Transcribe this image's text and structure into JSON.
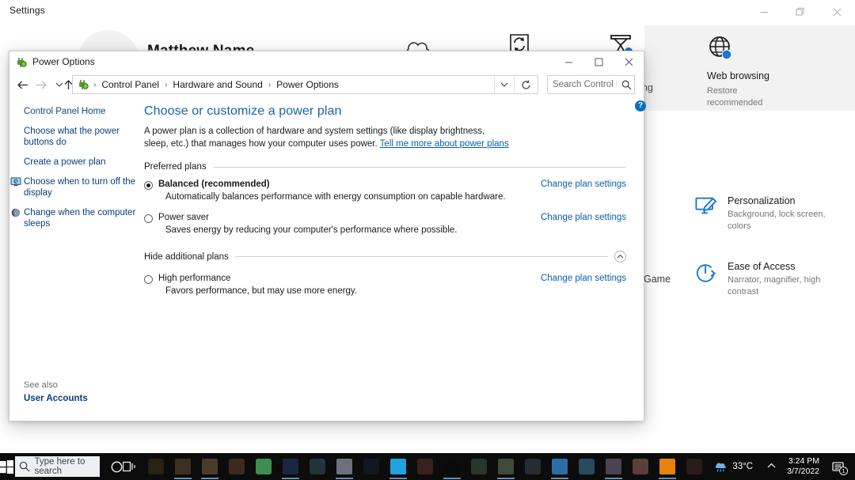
{
  "settings_app": {
    "title": "Settings",
    "window_controls": [
      {
        "name": "minimize",
        "glyph": "minimize-icon"
      },
      {
        "name": "restore",
        "glyph": "restore-icon"
      },
      {
        "name": "close",
        "glyph": "close-icon"
      }
    ],
    "partial_labels": {
      "gaming_fragment": "ng",
      "game_fragment": "Game"
    },
    "recommendation": {
      "icon": "globe-icon",
      "title": "Web browsing",
      "subtitle_line1": "Restore",
      "subtitle_line2": "recommended"
    },
    "tiles": [
      {
        "icon": "personalization-icon",
        "title": "Personalization",
        "subtitle": "Background, lock screen, colors"
      },
      {
        "icon": "ease-of-access-icon",
        "title": "Ease of Access",
        "subtitle": "Narrator, magnifier, high contrast"
      }
    ]
  },
  "power_options": {
    "window_title": "Power Options",
    "app_icon": "power-plug-icon",
    "window_controls": {
      "minimize": "minimize-icon",
      "maximize": "maximize-icon",
      "close": "close-icon"
    },
    "nav": {
      "back": "back-arrow-icon",
      "forward": "forward-arrow-icon",
      "recent": "recent-locations-icon",
      "up": "up-arrow-icon",
      "dropdown": "chevron-down-icon",
      "refresh": "refresh-icon"
    },
    "breadcrumb": [
      "Control Panel",
      "Hardware and Sound",
      "Power Options"
    ],
    "breadcrumb_separator": "›",
    "search": {
      "placeholder": "Search Control Panel",
      "value": "",
      "icon": "search-icon"
    },
    "help_badge": "?",
    "sidebar": {
      "items": [
        {
          "label": "Control Panel Home",
          "icon": null
        },
        {
          "label": "Choose what the power buttons do",
          "icon": null
        },
        {
          "label": "Create a power plan",
          "icon": null
        },
        {
          "label": "Choose when to turn off the display",
          "icon": "display-icon"
        },
        {
          "label": "Change when the computer sleeps",
          "icon": "moon-icon"
        }
      ],
      "see_also_label": "See also",
      "see_also_link": "User Accounts"
    },
    "main": {
      "heading": "Choose or customize a power plan",
      "description_part1": "A power plan is a collection of hardware and system settings (like display brightness, sleep, etc.) that manages how your computer uses power. ",
      "description_link": "Tell me more about power plans",
      "groups": [
        {
          "label": "Preferred plans",
          "expander": null,
          "plans": [
            {
              "name": "Balanced (recommended)",
              "selected": true,
              "bold": true,
              "description": "Automatically balances performance with energy consumption on capable hardware.",
              "link": "Change plan settings"
            },
            {
              "name": "Power saver",
              "selected": false,
              "bold": false,
              "description": "Saves energy by reducing your computer's performance where possible.",
              "link": "Change plan settings"
            }
          ]
        },
        {
          "label": "Hide additional plans",
          "expander": "chevron-up-icon",
          "plans": [
            {
              "name": "High performance",
              "selected": false,
              "bold": false,
              "description": "Favors performance, but may use more energy.",
              "link": "Change plan settings"
            }
          ]
        }
      ]
    }
  },
  "taskbar": {
    "start_icon": "windows-start-icon",
    "search": {
      "placeholder": "Type here to search",
      "icon": "search-icon"
    },
    "cortana_icon": "cortana-circle-icon",
    "task_view_icon": "task-view-icon",
    "apps": [
      {
        "name": "app-1",
        "color": "#2a2118",
        "active": false
      },
      {
        "name": "app-2",
        "color": "#3b3022",
        "active": true
      },
      {
        "name": "app-3",
        "color": "#4a3b2b",
        "active": true
      },
      {
        "name": "app-4",
        "color": "#3c2a22",
        "active": false
      },
      {
        "name": "app-5",
        "color": "#3e8e4f",
        "active": false
      },
      {
        "name": "app-6",
        "color": "#1b2640",
        "active": true
      },
      {
        "name": "app-7",
        "color": "#23333a",
        "active": false
      },
      {
        "name": "app-8",
        "color": "#6c7279",
        "active": true
      },
      {
        "name": "app-9",
        "color": "#111820",
        "active": false
      },
      {
        "name": "app-10",
        "color": "#1fa2e0",
        "active": true
      },
      {
        "name": "app-11",
        "color": "#3a1f1f",
        "active": false
      },
      {
        "name": "app-12",
        "color": "#0b0b0b",
        "active": true
      },
      {
        "name": "app-13",
        "color": "#27372b",
        "active": false
      },
      {
        "name": "app-14",
        "color": "#3f4a3a",
        "active": true
      },
      {
        "name": "app-15",
        "color": "#272b33",
        "active": false
      },
      {
        "name": "app-16",
        "color": "#2d6ea8",
        "active": true
      },
      {
        "name": "app-17",
        "color": "#2b4a5e",
        "active": false
      },
      {
        "name": "app-18",
        "color": "#4a4450",
        "active": true
      },
      {
        "name": "app-19",
        "color": "#5a4038",
        "active": false
      },
      {
        "name": "app-file-explorer",
        "color": "#e8820c",
        "active": true
      },
      {
        "name": "app-21",
        "color": "#2a1c1c",
        "active": false
      }
    ],
    "tray": {
      "weather_icon": "cloud-rain-icon",
      "temperature": "33°C",
      "chevron": "chevron-up-icon",
      "time": "3:24 PM",
      "date": "3/7/2022",
      "notification_icon": "notification-icon",
      "notification_count": "1"
    }
  },
  "colors": {
    "accent_blue": "#0c6ebc",
    "link_blue": "#0a5fa8",
    "heading_blue": "#1665a8",
    "taskbar_bg": "#0c0c0c",
    "panel_gray": "#f2f2f2"
  }
}
